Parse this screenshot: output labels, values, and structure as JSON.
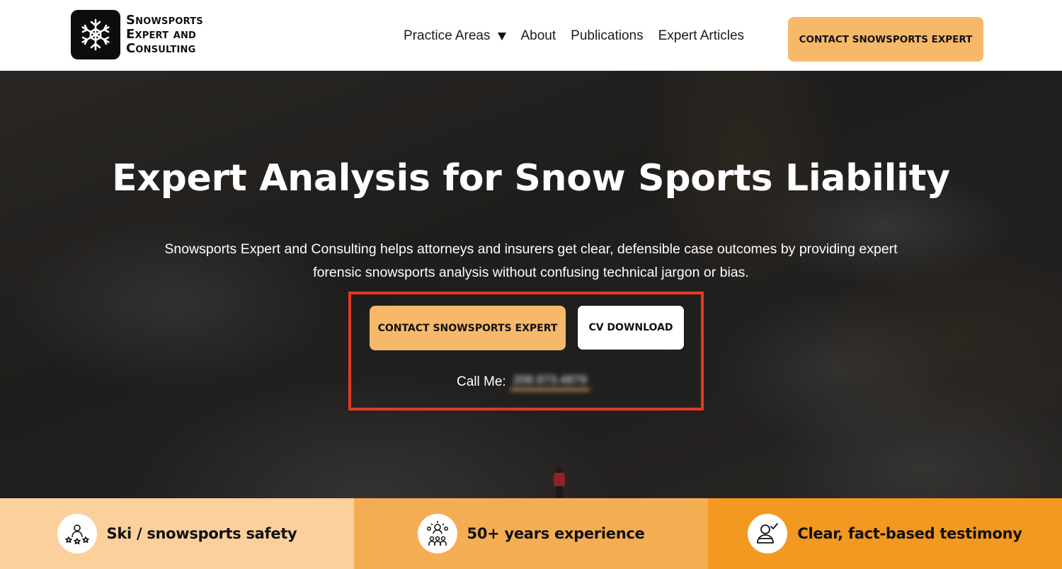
{
  "header": {
    "logo_lines": [
      "Snowsports",
      "Expert and",
      "Consulting"
    ],
    "logo_icon": "snowflake-icon",
    "nav": [
      {
        "label": "Practice Areas",
        "has_dropdown": true
      },
      {
        "label": "About"
      },
      {
        "label": "Publications"
      },
      {
        "label": "Expert Articles"
      }
    ],
    "cta_label": "CONTACT SNOWSPORTS EXPERT"
  },
  "hero": {
    "title": "Expert Analysis for Snow Sports Liability",
    "subtitle": "Snowsports Expert and Consulting helps attorneys and insurers get clear, defensible case outcomes by providing expert forensic snowsports analysis without confusing technical jargon or bias.",
    "primary_cta": "CONTACT SNOWSPORTS EXPERT",
    "secondary_cta": "CV DOWNLOAD",
    "call_label": "Call Me:",
    "phone": "208.973.4879",
    "highlight_color": "#e23a22"
  },
  "features": [
    {
      "icon": "ski-safety-icon",
      "label": "Ski / snowsports safety",
      "color": "#fbd09c"
    },
    {
      "icon": "team-experience-icon",
      "label": "50+ years experience",
      "color": "#f5ad53"
    },
    {
      "icon": "testimony-check-icon",
      "label": "Clear, fact-based testimony",
      "color": "#f39820"
    }
  ],
  "colors": {
    "accent": "#f6b96a",
    "text": "#111111"
  }
}
